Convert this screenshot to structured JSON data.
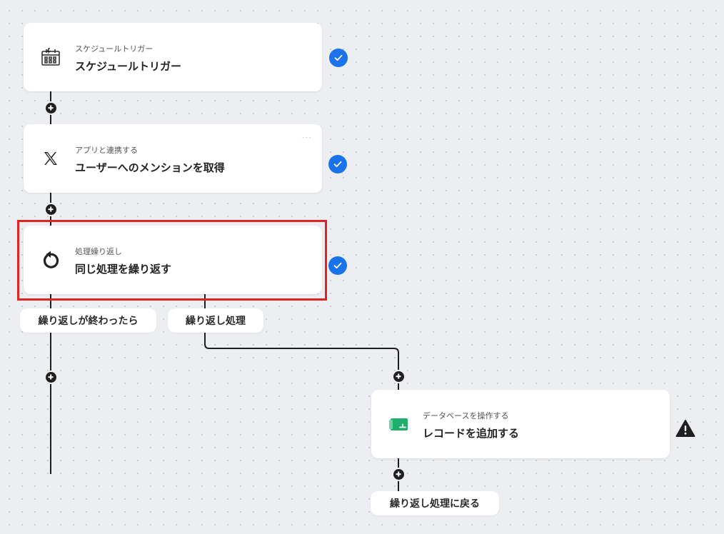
{
  "flow": {
    "steps": [
      {
        "subtitle": "スケジュールトリガー",
        "title": "スケジュールトリガー",
        "icon": "calendar-clock-icon",
        "status": "completed"
      },
      {
        "subtitle": "アプリと連携する",
        "title": "ユーザーへのメンションを取得",
        "icon": "x-logo-icon",
        "status": "completed",
        "menu": "···"
      },
      {
        "subtitle": "処理繰り返し",
        "title": "同じ処理を繰り返す",
        "icon": "loop-arrow-icon",
        "status": "completed",
        "highlighted": true
      },
      {
        "subtitle": "データベースを操作する",
        "title": "レコードを追加する",
        "icon": "database-icon",
        "status": "warning"
      }
    ],
    "branches": {
      "after_loop": "繰り返しが終わったら",
      "loop_body": "繰り返し処理",
      "return": "繰り返し処理に戻る"
    }
  },
  "colors": {
    "check": "#1a73e8",
    "highlight": "#e02424",
    "warning": "#1f1f1f",
    "database_icon": "#1fae6b"
  }
}
